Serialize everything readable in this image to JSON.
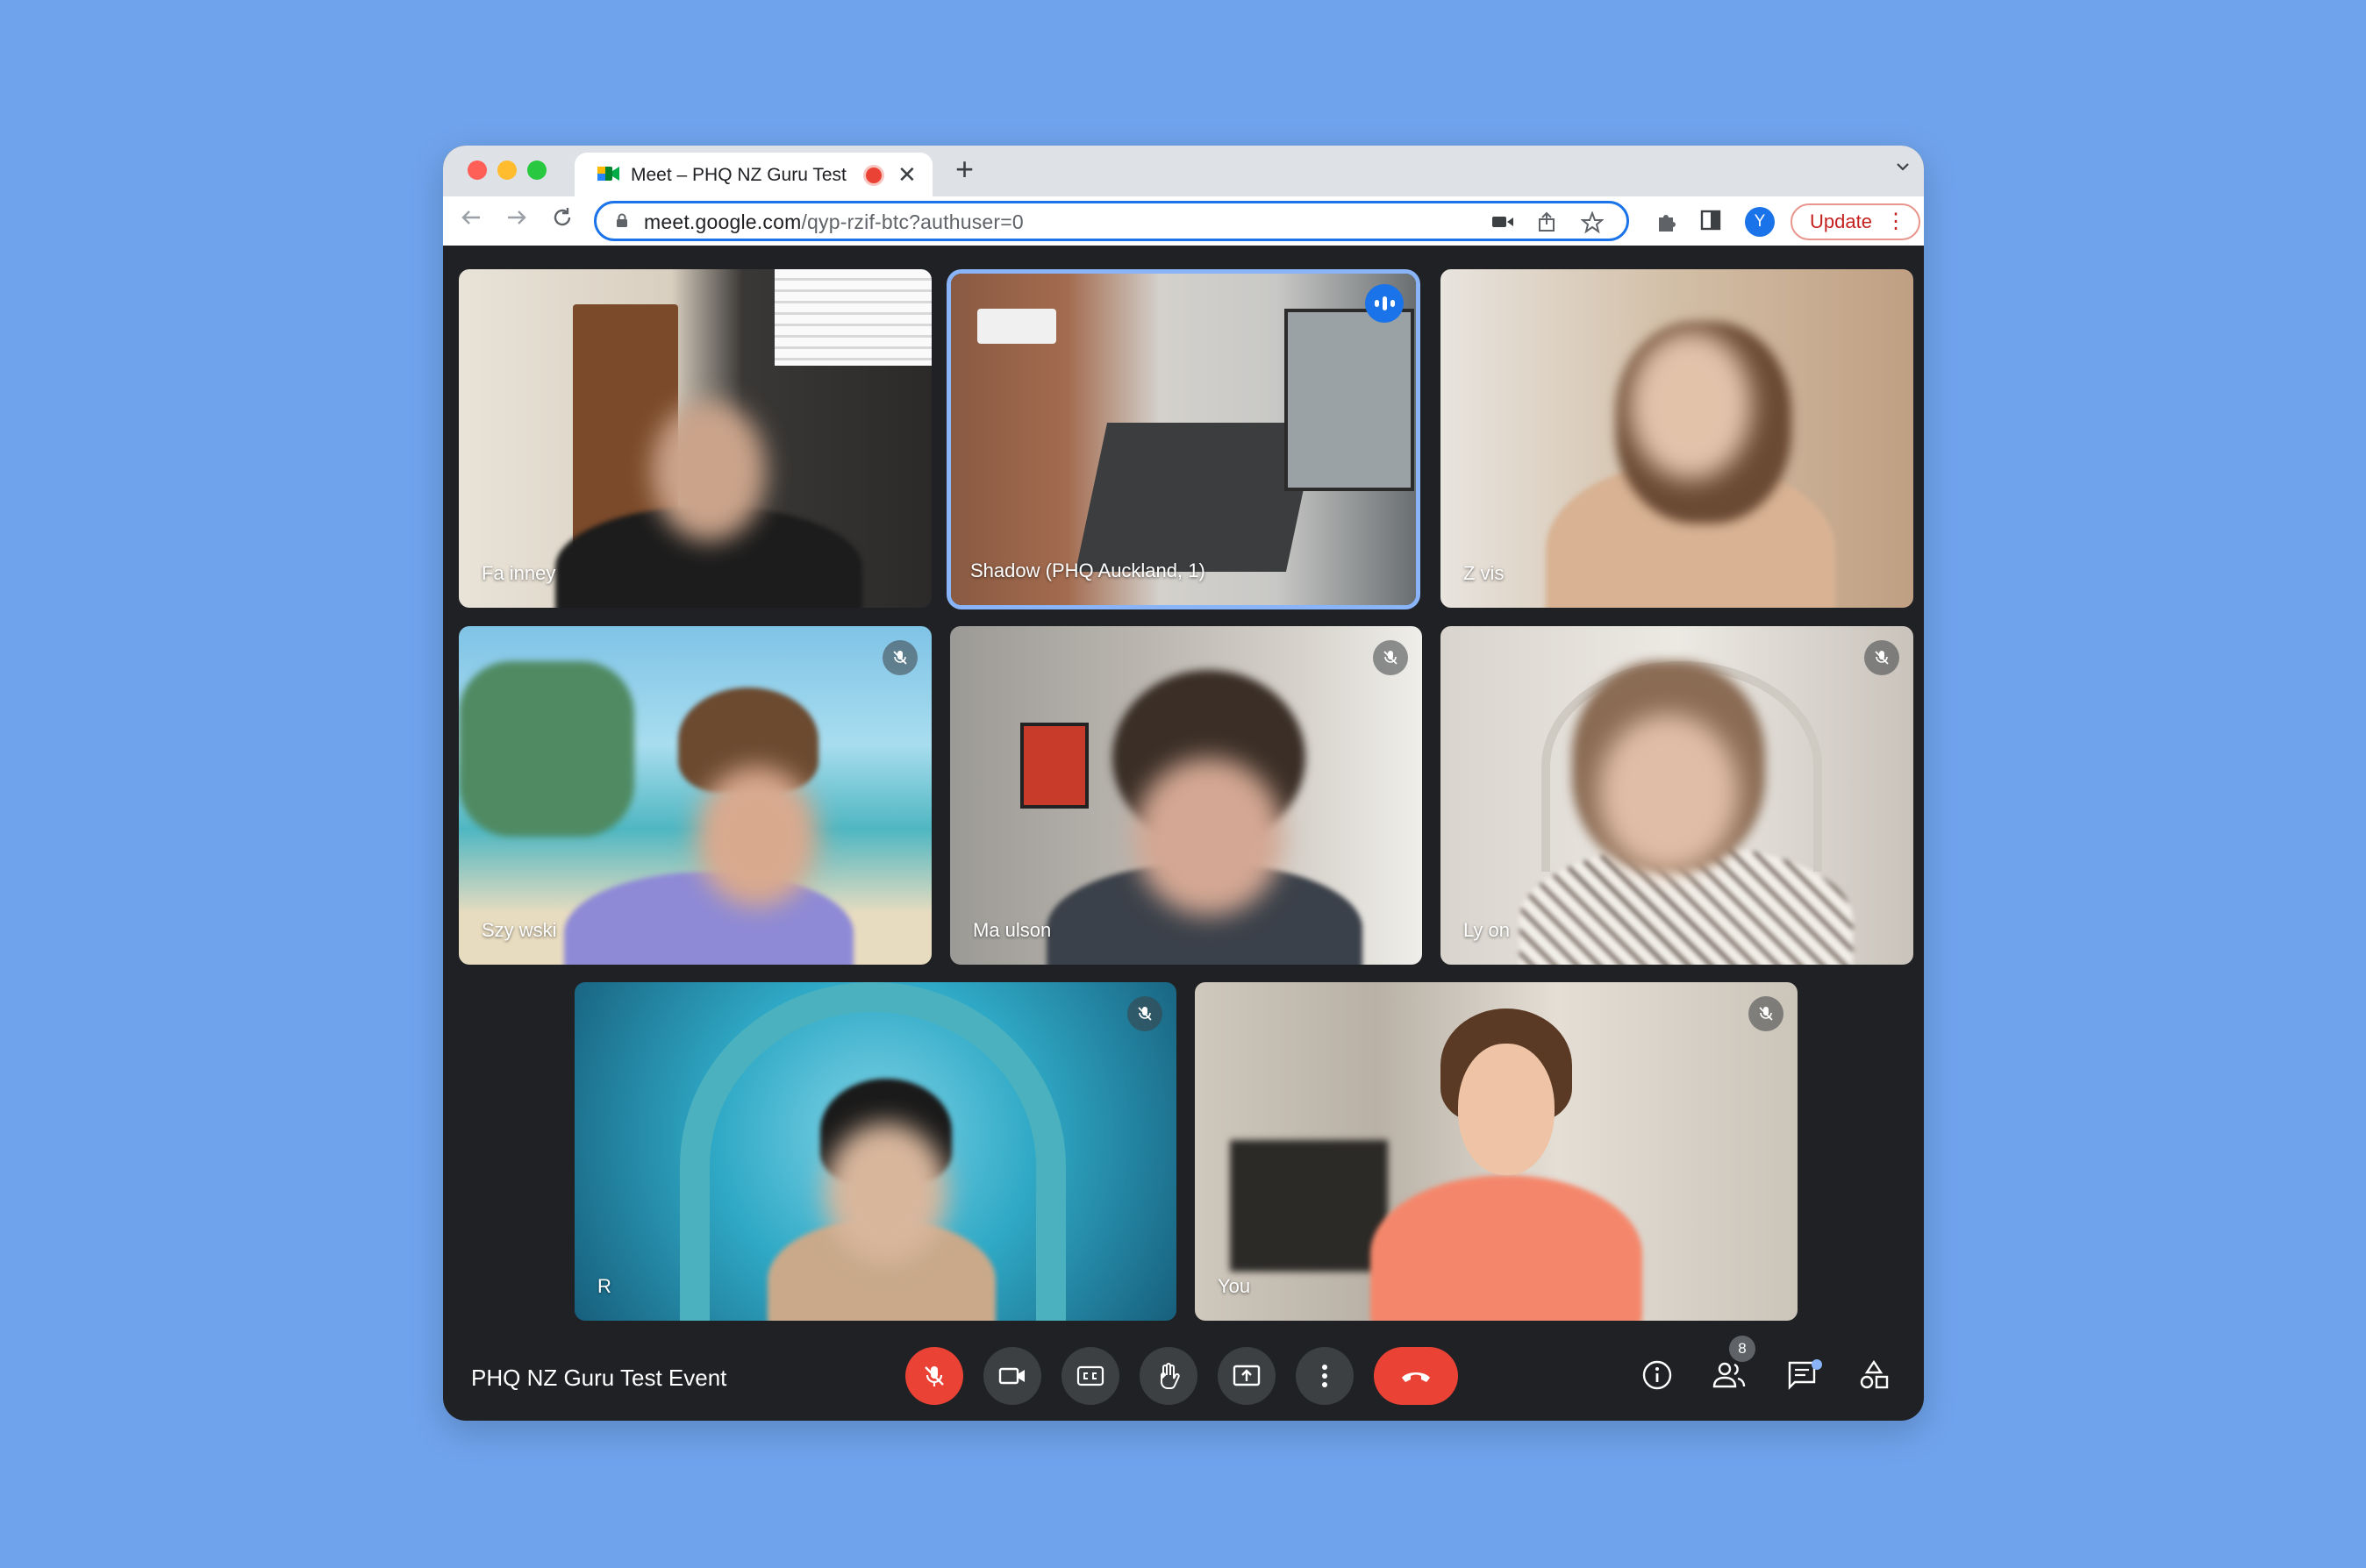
{
  "browser": {
    "tab_title": "Meet – PHQ NZ Guru Test Event",
    "url_domain": "meet.google.com",
    "url_path": "/qyp-rzif-btc?authuser=0",
    "avatar_letter": "Y",
    "update_label": "Update",
    "new_tab_glyph": "+",
    "close_glyph": "✕"
  },
  "participants": [
    {
      "name": "Fa          inney",
      "muted": false,
      "speaking": false
    },
    {
      "name": "Shadow (PHQ Auckland, 1)",
      "muted": false,
      "speaking": true
    },
    {
      "name": "Z         vis",
      "muted": false,
      "speaking": false
    },
    {
      "name": "Szy              wski",
      "muted": true,
      "speaking": false
    },
    {
      "name": "Ma                     ulson",
      "muted": true,
      "speaking": false
    },
    {
      "name": "Ly              on",
      "muted": true,
      "speaking": false
    },
    {
      "name": "R",
      "muted": true,
      "speaking": false
    },
    {
      "name": "You",
      "muted": true,
      "speaking": false
    }
  ],
  "meeting": {
    "title": "PHQ NZ Guru Test Event",
    "participant_count": "8"
  },
  "colors": {
    "background": "#6fa3ec",
    "meet_dark": "#202124",
    "control_gray": "#3c4043",
    "danger_red": "#ea4335",
    "accent_blue": "#1a73e8"
  },
  "icons": {
    "mic_off": "mic-off-icon",
    "camera": "camera-icon",
    "captions": "captions-icon",
    "raise_hand": "hand-icon",
    "present": "present-icon",
    "more": "more-vert-icon",
    "leave": "phone-hangup-icon",
    "info": "info-icon",
    "people": "people-icon",
    "chat": "chat-icon",
    "activities": "activities-icon"
  }
}
